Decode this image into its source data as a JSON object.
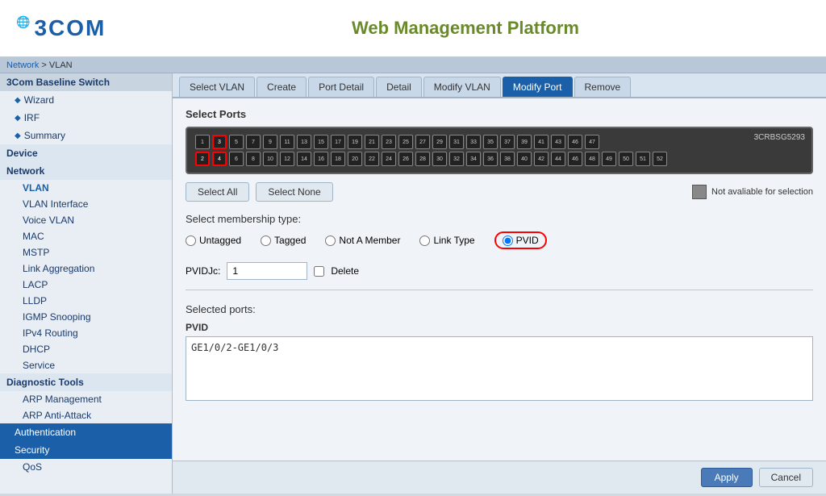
{
  "header": {
    "title": "Web Management Platform",
    "logo": "3COM"
  },
  "breadcrumb": {
    "items": [
      "Network",
      "VLAN"
    ],
    "separator": " > "
  },
  "sidebar": {
    "switch_label": "3Com Baseline Switch",
    "items": [
      {
        "id": "wizard",
        "label": "Wizard",
        "type": "diamond"
      },
      {
        "id": "irf",
        "label": "IRF",
        "type": "diamond"
      },
      {
        "id": "summary",
        "label": "Summary",
        "type": "diamond"
      }
    ],
    "groups": [
      {
        "id": "device",
        "label": "Device",
        "items": []
      },
      {
        "id": "network",
        "label": "Network",
        "items": [
          {
            "id": "vlan",
            "label": "VLAN",
            "active": true
          },
          {
            "id": "vlan-interface",
            "label": "VLAN Interface"
          },
          {
            "id": "voice-vlan",
            "label": "Voice VLAN"
          },
          {
            "id": "mac",
            "label": "MAC"
          },
          {
            "id": "mstp",
            "label": "MSTP"
          },
          {
            "id": "link-aggregation",
            "label": "Link Aggregation"
          },
          {
            "id": "lacp",
            "label": "LACP"
          },
          {
            "id": "lldp",
            "label": "LLDP"
          },
          {
            "id": "igmp-snooping",
            "label": "IGMP Snooping"
          },
          {
            "id": "ipv4-routing",
            "label": "IPv4 Routing"
          },
          {
            "id": "dhcp",
            "label": "DHCP"
          },
          {
            "id": "service",
            "label": "Service"
          }
        ]
      },
      {
        "id": "diagnostic-tools",
        "label": "Diagnostic Tools"
      },
      {
        "id": "arp-management",
        "label": "ARP Management"
      },
      {
        "id": "arp-anti-attack",
        "label": "ARP Anti-Attack"
      },
      {
        "id": "authentication",
        "label": "Authentication",
        "highlight": true
      },
      {
        "id": "security",
        "label": "Security",
        "highlight": true
      },
      {
        "id": "qos",
        "label": "QoS"
      }
    ]
  },
  "tabs": [
    {
      "id": "select-vlan",
      "label": "Select VLAN"
    },
    {
      "id": "create",
      "label": "Create"
    },
    {
      "id": "port-detail",
      "label": "Port Detail"
    },
    {
      "id": "detail",
      "label": "Detail"
    },
    {
      "id": "modify-vlan",
      "label": "Modify VLAN"
    },
    {
      "id": "modify-port",
      "label": "Modify Port",
      "active": true
    },
    {
      "id": "remove",
      "label": "Remove"
    }
  ],
  "content": {
    "select_ports_label": "Select Ports",
    "switch_model": "3CRBSG5293",
    "port_rows": {
      "top": [
        "1",
        "3",
        "5",
        "7",
        "9",
        "11",
        "13",
        "15",
        "17",
        "19",
        "21",
        "23",
        "25",
        "27",
        "29",
        "31",
        "33",
        "35",
        "37",
        "39",
        "41",
        "43",
        "46",
        "47"
      ],
      "bottom": [
        "2",
        "4",
        "6",
        "8",
        "10",
        "12",
        "14",
        "16",
        "18",
        "20",
        "22",
        "24",
        "26",
        "28",
        "30",
        "32",
        "34",
        "36",
        "38",
        "40",
        "42",
        "44",
        "46",
        "48",
        "49",
        "50",
        "51",
        "52"
      ],
      "selected_top": [
        "3"
      ],
      "selected_bottom": [
        "2",
        "4"
      ]
    },
    "select_all_btn": "Select All",
    "select_none_btn": "Select None",
    "not_available_legend": "Not avaliable for selection",
    "membership_type_label": "Select membership type:",
    "radio_options": [
      {
        "id": "untagged",
        "label": "Untagged"
      },
      {
        "id": "tagged",
        "label": "Tagged"
      },
      {
        "id": "not-a-member",
        "label": "Not A Member"
      },
      {
        "id": "link-type",
        "label": "Link Type"
      },
      {
        "id": "pvid",
        "label": "PVID",
        "selected": true
      }
    ],
    "pvid_label": "PVIDJc:",
    "pvid_value": "1",
    "delete_label": "Delete",
    "selected_ports_label": "Selected ports:",
    "pvid_column_label": "PVID",
    "selected_ports_value": "GE1/0/2-GE1/0/3"
  },
  "footer": {
    "apply_btn": "Apply",
    "cancel_btn": "Cancel"
  }
}
